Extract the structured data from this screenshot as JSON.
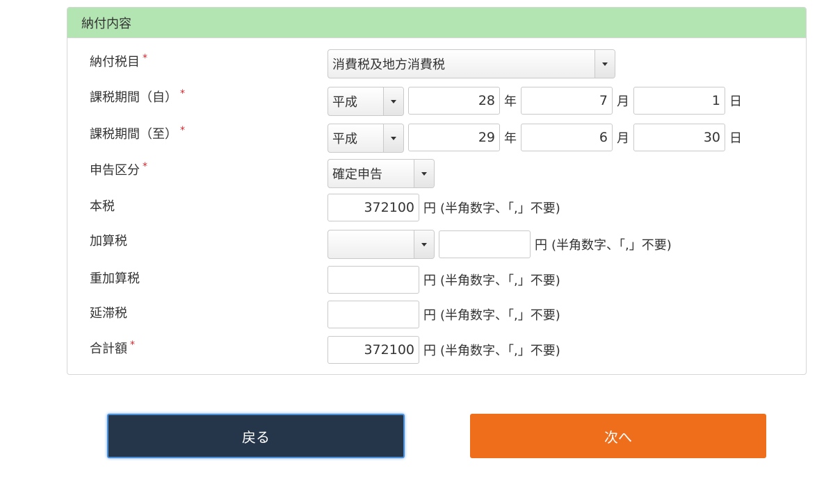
{
  "panel": {
    "title": "納付内容"
  },
  "fields": {
    "tax_item": {
      "label": "納付税目",
      "required_mark": "*",
      "value": "消費税及地方消費税"
    },
    "period_from": {
      "label": "課税期間（自）",
      "required_mark": "*",
      "era": "平成",
      "year": "28",
      "year_unit": "年",
      "month": "7",
      "month_unit": "月",
      "day": "1",
      "day_unit": "日"
    },
    "period_to": {
      "label": "課税期間（至）",
      "required_mark": "*",
      "era": "平成",
      "year": "29",
      "year_unit": "年",
      "month": "6",
      "month_unit": "月",
      "day": "30",
      "day_unit": "日"
    },
    "declaration_type": {
      "label": "申告区分",
      "required_mark": "*",
      "value": "確定申告"
    },
    "principal_tax": {
      "label": "本税",
      "value": "372100",
      "unit": "円",
      "note": "(半角数字、「,」不要)"
    },
    "additional_tax": {
      "label": "加算税",
      "select_value": "",
      "value": "",
      "unit": "円",
      "note": "(半角数字、「,」不要)"
    },
    "heavy_additional_tax": {
      "label": "重加算税",
      "value": "",
      "unit": "円",
      "note": "(半角数字、「,」不要)"
    },
    "delinquency_tax": {
      "label": "延滞税",
      "value": "",
      "unit": "円",
      "note": "(半角数字、「,」不要)"
    },
    "total": {
      "label": "合計額",
      "required_mark": "*",
      "value": "372100",
      "unit": "円",
      "note": "(半角数字、「,」不要)"
    }
  },
  "buttons": {
    "back": "戻る",
    "next": "次へ"
  },
  "colors": {
    "header_bg": "#b3e5b3",
    "required": "#d9262c",
    "back_button": "#26364a",
    "next_button": "#ee6e1c"
  }
}
